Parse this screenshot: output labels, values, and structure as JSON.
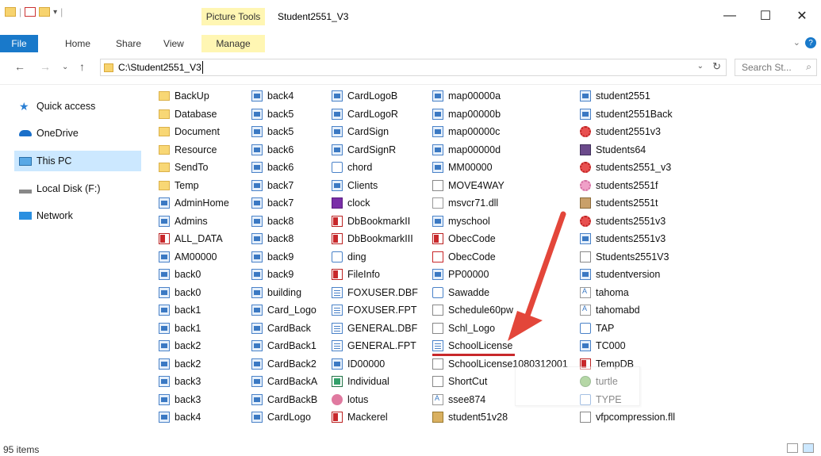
{
  "window": {
    "title": "Student2551_V3",
    "contextual_group": "Picture Tools",
    "controls": {
      "minimize": "—",
      "maximize": "☐",
      "close": "✕"
    }
  },
  "ribbon": {
    "file": "File",
    "tabs": [
      "Home",
      "Share",
      "View"
    ],
    "manage": "Manage"
  },
  "address": {
    "path": "C:\\Student2551_V3",
    "search_placeholder": "Search St..."
  },
  "sidebar": {
    "items": [
      {
        "label": "Quick access",
        "icon": "star-icon"
      },
      {
        "label": "OneDrive",
        "icon": "cloud-icon"
      },
      {
        "label": "This PC",
        "icon": "monitor-icon",
        "selected": true
      },
      {
        "label": "Local Disk (F:)",
        "icon": "drive-icon"
      },
      {
        "label": "Network",
        "icon": "network-icon"
      }
    ]
  },
  "files": {
    "columns": [
      [
        {
          "name": "BackUp",
          "icon": "folder"
        },
        {
          "name": "Database",
          "icon": "folder"
        },
        {
          "name": "Document",
          "icon": "folder"
        },
        {
          "name": "Resource",
          "icon": "folder"
        },
        {
          "name": "SendTo",
          "icon": "folder"
        },
        {
          "name": "Temp",
          "icon": "folder"
        },
        {
          "name": "AdminHome",
          "icon": "img"
        },
        {
          "name": "Admins",
          "icon": "img"
        },
        {
          "name": "ALL_DATA",
          "icon": "pdf"
        },
        {
          "name": "AM00000",
          "icon": "img"
        },
        {
          "name": "back0",
          "icon": "img"
        },
        {
          "name": "back0",
          "icon": "img"
        },
        {
          "name": "back1",
          "icon": "img"
        },
        {
          "name": "back1",
          "icon": "img"
        },
        {
          "name": "back2",
          "icon": "img"
        },
        {
          "name": "back2",
          "icon": "img"
        },
        {
          "name": "back3",
          "icon": "img"
        },
        {
          "name": "back3",
          "icon": "img"
        },
        {
          "name": "back4",
          "icon": "img"
        }
      ],
      [
        {
          "name": "back4",
          "icon": "img"
        },
        {
          "name": "back5",
          "icon": "img"
        },
        {
          "name": "back5",
          "icon": "img"
        },
        {
          "name": "back6",
          "icon": "img"
        },
        {
          "name": "back6",
          "icon": "img"
        },
        {
          "name": "back7",
          "icon": "img"
        },
        {
          "name": "back7",
          "icon": "img"
        },
        {
          "name": "back8",
          "icon": "img"
        },
        {
          "name": "back8",
          "icon": "img"
        },
        {
          "name": "back9",
          "icon": "img"
        },
        {
          "name": "back9",
          "icon": "img"
        },
        {
          "name": "building",
          "icon": "img"
        },
        {
          "name": "Card_Logo",
          "icon": "img"
        },
        {
          "name": "CardBack",
          "icon": "img"
        },
        {
          "name": "CardBack1",
          "icon": "img"
        },
        {
          "name": "CardBack2",
          "icon": "img"
        },
        {
          "name": "CardBackA",
          "icon": "img"
        },
        {
          "name": "CardBackB",
          "icon": "img"
        },
        {
          "name": "CardLogo",
          "icon": "img"
        }
      ],
      [
        {
          "name": "CardLogoB",
          "icon": "img"
        },
        {
          "name": "CardLogoR",
          "icon": "img"
        },
        {
          "name": "CardSign",
          "icon": "img"
        },
        {
          "name": "CardSignR",
          "icon": "img"
        },
        {
          "name": "chord",
          "icon": "web"
        },
        {
          "name": "Clients",
          "icon": "img"
        },
        {
          "name": "clock",
          "icon": "flash"
        },
        {
          "name": "DbBookmarkII",
          "icon": "pdf"
        },
        {
          "name": "DbBookmarkIII",
          "icon": "pdf"
        },
        {
          "name": "ding",
          "icon": "web"
        },
        {
          "name": "FileInfo",
          "icon": "pdf"
        },
        {
          "name": "FOXUSER.DBF",
          "icon": "dbf"
        },
        {
          "name": "FOXUSER.FPT",
          "icon": "dbf"
        },
        {
          "name": "GENERAL.DBF",
          "icon": "dbf"
        },
        {
          "name": "GENERAL.FPT",
          "icon": "dbf"
        },
        {
          "name": "ID00000",
          "icon": "img"
        },
        {
          "name": "Individual",
          "icon": "xls"
        },
        {
          "name": "lotus",
          "icon": "flower"
        },
        {
          "name": "Mackerel",
          "icon": "pdf"
        }
      ],
      [
        {
          "name": "map00000a",
          "icon": "img"
        },
        {
          "name": "map00000b",
          "icon": "img"
        },
        {
          "name": "map00000c",
          "icon": "img"
        },
        {
          "name": "map00000d",
          "icon": "img"
        },
        {
          "name": "MM00000",
          "icon": "img"
        },
        {
          "name": "MOVE4WAY",
          "icon": "doc"
        },
        {
          "name": "msvcr71.dll",
          "icon": "gear"
        },
        {
          "name": "myschool",
          "icon": "img"
        },
        {
          "name": "ObecCode",
          "icon": "pdf"
        },
        {
          "name": "ObecCode",
          "icon": "ppt"
        },
        {
          "name": "PP00000",
          "icon": "img"
        },
        {
          "name": "Sawadde",
          "icon": "web"
        },
        {
          "name": "Schedule60pw",
          "icon": "doc"
        },
        {
          "name": "Schl_Logo",
          "icon": "doc"
        },
        {
          "name": "SchoolLicense",
          "icon": "dbf"
        },
        {
          "name": "SchoolLicense1080312001",
          "icon": "doc"
        },
        {
          "name": "ShortCut",
          "icon": "doc"
        },
        {
          "name": "ssee874",
          "icon": "font"
        },
        {
          "name": "student51v28",
          "icon": "box"
        }
      ],
      [
        {
          "name": "student2551",
          "icon": "img"
        },
        {
          "name": "student2551Back",
          "icon": "img"
        },
        {
          "name": "student2551v3",
          "icon": "pink"
        },
        {
          "name": "Students64",
          "icon": "db"
        },
        {
          "name": "students2551_v3",
          "icon": "pink"
        },
        {
          "name": "students2551f",
          "icon": "ltpink"
        },
        {
          "name": "students2551t",
          "icon": "cup"
        },
        {
          "name": "students2551v3",
          "icon": "pink"
        },
        {
          "name": "students2551v3",
          "icon": "img"
        },
        {
          "name": "Students2551V3",
          "icon": "doc"
        },
        {
          "name": "studentversion",
          "icon": "img"
        },
        {
          "name": "tahoma",
          "icon": "font"
        },
        {
          "name": "tahomabd",
          "icon": "font"
        },
        {
          "name": "TAP",
          "icon": "web"
        },
        {
          "name": "TC000",
          "icon": "img"
        },
        {
          "name": "TempDB",
          "icon": "pdf"
        },
        {
          "name": "turtle",
          "icon": "turtle"
        },
        {
          "name": "TYPE",
          "icon": "web"
        },
        {
          "name": "vfpcompression.fll",
          "icon": "doc"
        }
      ]
    ]
  },
  "status": {
    "count": "95 items"
  }
}
